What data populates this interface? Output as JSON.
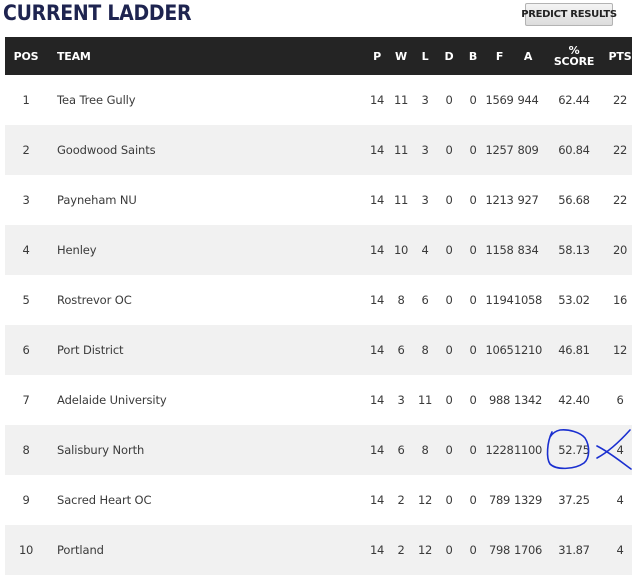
{
  "header": {
    "title": "CURRENT LADDER",
    "predict_button": "PREDICT RESULTS"
  },
  "columns": {
    "pos": "POS",
    "team": "TEAM",
    "p": "P",
    "w": "W",
    "l": "L",
    "d": "D",
    "b": "B",
    "f": "F",
    "a": "A",
    "pct_line1": "%",
    "pct_line2": "SCORE",
    "pts": "PTS"
  },
  "rows": [
    {
      "pos": "1",
      "team": "Tea Tree Gully",
      "p": "14",
      "w": "11",
      "l": "3",
      "d": "0",
      "b": "0",
      "f": "1569",
      "a": "944",
      "pct": "62.44",
      "pts": "22"
    },
    {
      "pos": "2",
      "team": "Goodwood Saints",
      "p": "14",
      "w": "11",
      "l": "3",
      "d": "0",
      "b": "0",
      "f": "1257",
      "a": "809",
      "pct": "60.84",
      "pts": "22"
    },
    {
      "pos": "3",
      "team": "Payneham NU",
      "p": "14",
      "w": "11",
      "l": "3",
      "d": "0",
      "b": "0",
      "f": "1213",
      "a": "927",
      "pct": "56.68",
      "pts": "22"
    },
    {
      "pos": "4",
      "team": "Henley",
      "p": "14",
      "w": "10",
      "l": "4",
      "d": "0",
      "b": "0",
      "f": "1158",
      "a": "834",
      "pct": "58.13",
      "pts": "20"
    },
    {
      "pos": "5",
      "team": "Rostrevor OC",
      "p": "14",
      "w": "8",
      "l": "6",
      "d": "0",
      "b": "0",
      "f": "1194",
      "a": "1058",
      "pct": "53.02",
      "pts": "16"
    },
    {
      "pos": "6",
      "team": "Port District",
      "p": "14",
      "w": "6",
      "l": "8",
      "d": "0",
      "b": "0",
      "f": "1065",
      "a": "1210",
      "pct": "46.81",
      "pts": "12"
    },
    {
      "pos": "7",
      "team": "Adelaide University",
      "p": "14",
      "w": "3",
      "l": "11",
      "d": "0",
      "b": "0",
      "f": "988",
      "a": "1342",
      "pct": "42.40",
      "pts": "6"
    },
    {
      "pos": "8",
      "team": "Salisbury North",
      "p": "14",
      "w": "6",
      "l": "8",
      "d": "0",
      "b": "0",
      "f": "1228",
      "a": "1100",
      "pct": "52.75",
      "pts": "4"
    },
    {
      "pos": "9",
      "team": "Sacred Heart OC",
      "p": "14",
      "w": "2",
      "l": "12",
      "d": "0",
      "b": "0",
      "f": "789",
      "a": "1329",
      "pct": "37.25",
      "pts": "4"
    },
    {
      "pos": "10",
      "team": "Portland",
      "p": "14",
      "w": "2",
      "l": "12",
      "d": "0",
      "b": "0",
      "f": "798",
      "a": "1706",
      "pct": "31.87",
      "pts": "4"
    }
  ],
  "colors": {
    "title": "#1e2450",
    "header_bg": "#242424",
    "row_alt": "#f1f1f1",
    "annotation": "#1a2fd0"
  }
}
